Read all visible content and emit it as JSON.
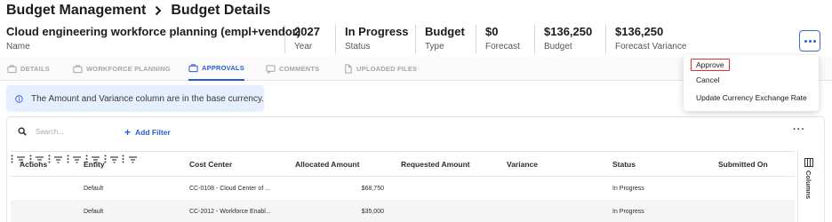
{
  "breadcrumb": {
    "parent": "Budget Management",
    "current": "Budget Details"
  },
  "summary": [
    {
      "value": "Cloud engineering workforce planning (empl+vendor)",
      "label": "Name"
    },
    {
      "value": "2027",
      "label": "Year"
    },
    {
      "value": "In Progress",
      "label": "Status"
    },
    {
      "value": "Budget",
      "label": "Type"
    },
    {
      "value": "$0",
      "label": "Forecast"
    },
    {
      "value": "$136,250",
      "label": "Budget"
    },
    {
      "value": "$136,250",
      "label": "Forecast Variance"
    }
  ],
  "tabs": [
    {
      "label": "DETAILS",
      "icon": "briefcase-icon"
    },
    {
      "label": "WORKFORCE PLANNING",
      "icon": "briefcase-icon"
    },
    {
      "label": "APPROVALS",
      "icon": "briefcase-icon",
      "active": true
    },
    {
      "label": "COMMENTS",
      "icon": "comment-icon"
    },
    {
      "label": "UPLOADED FILES",
      "icon": "file-icon"
    }
  ],
  "info": {
    "text": "The Amount and Variance column are in the base currency."
  },
  "toolbar": {
    "search_placeholder": "Search...",
    "add_filter": "Add Filter"
  },
  "table": {
    "columns": [
      "Actions",
      "Entity",
      "Cost Center",
      "Allocated Amount",
      "Requested Amount",
      "Variance",
      "Status",
      "Submitted On"
    ],
    "rows": [
      [
        "",
        "Default",
        "CC-0108 - Cloud Center of ...",
        "$68,750",
        "",
        "",
        "In Progress",
        ""
      ],
      [
        "",
        "Default",
        "CC-2012 - Workforce Enabl...",
        "$35,000",
        "",
        "",
        "In Progress",
        ""
      ]
    ]
  },
  "side_panel": {
    "label": "Columns"
  },
  "menu": {
    "items": [
      "Approve",
      "Cancel",
      "Update Currency Exchange Rate"
    ]
  },
  "colors": {
    "accent": "#2a5bd7",
    "info_bg": "#e6efff",
    "highlight": "#dd3333"
  }
}
